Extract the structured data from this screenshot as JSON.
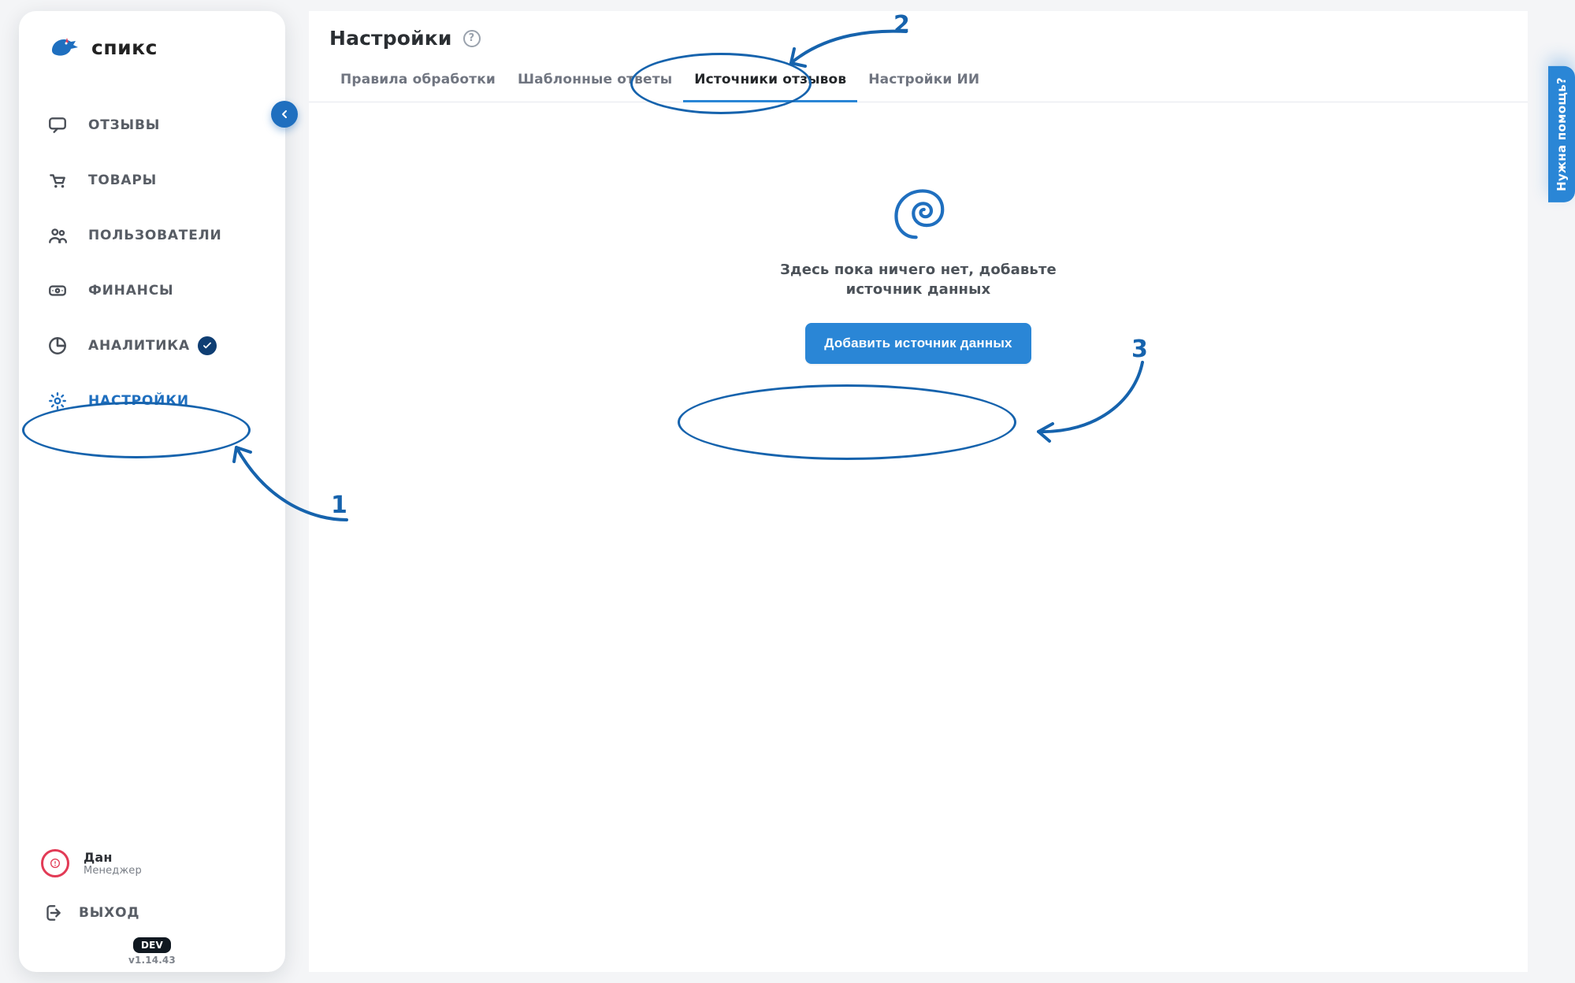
{
  "brand": {
    "name": "спикс"
  },
  "sidebar": {
    "items": [
      {
        "label": "ОТЗЫВЫ"
      },
      {
        "label": "ТОВАРЫ"
      },
      {
        "label": "ПОЛЬЗОВАТЕЛИ"
      },
      {
        "label": "ФИНАНСЫ"
      },
      {
        "label": "АНАЛИТИКА"
      },
      {
        "label": "НАСТРОЙКИ"
      }
    ],
    "user": {
      "name": "Дан",
      "role": "Менеджер"
    },
    "logout_label": "ВЫХОД",
    "dev_tag": "DEV",
    "version": "v1.14.43"
  },
  "page": {
    "title": "Настройки",
    "tabs": [
      "Правила обработки",
      "Шаблонные ответы",
      "Источники отзывов",
      "Настройки ИИ"
    ],
    "active_tab_index": 2,
    "empty_title": "Здесь пока ничего нет, добавьте",
    "empty_title_line2": "источник данных",
    "cta_label": "Добавить источник данных"
  },
  "help_tab": "Нужна помощь?",
  "annotations": {
    "n1": "1",
    "n2": "2",
    "n3": "3"
  }
}
